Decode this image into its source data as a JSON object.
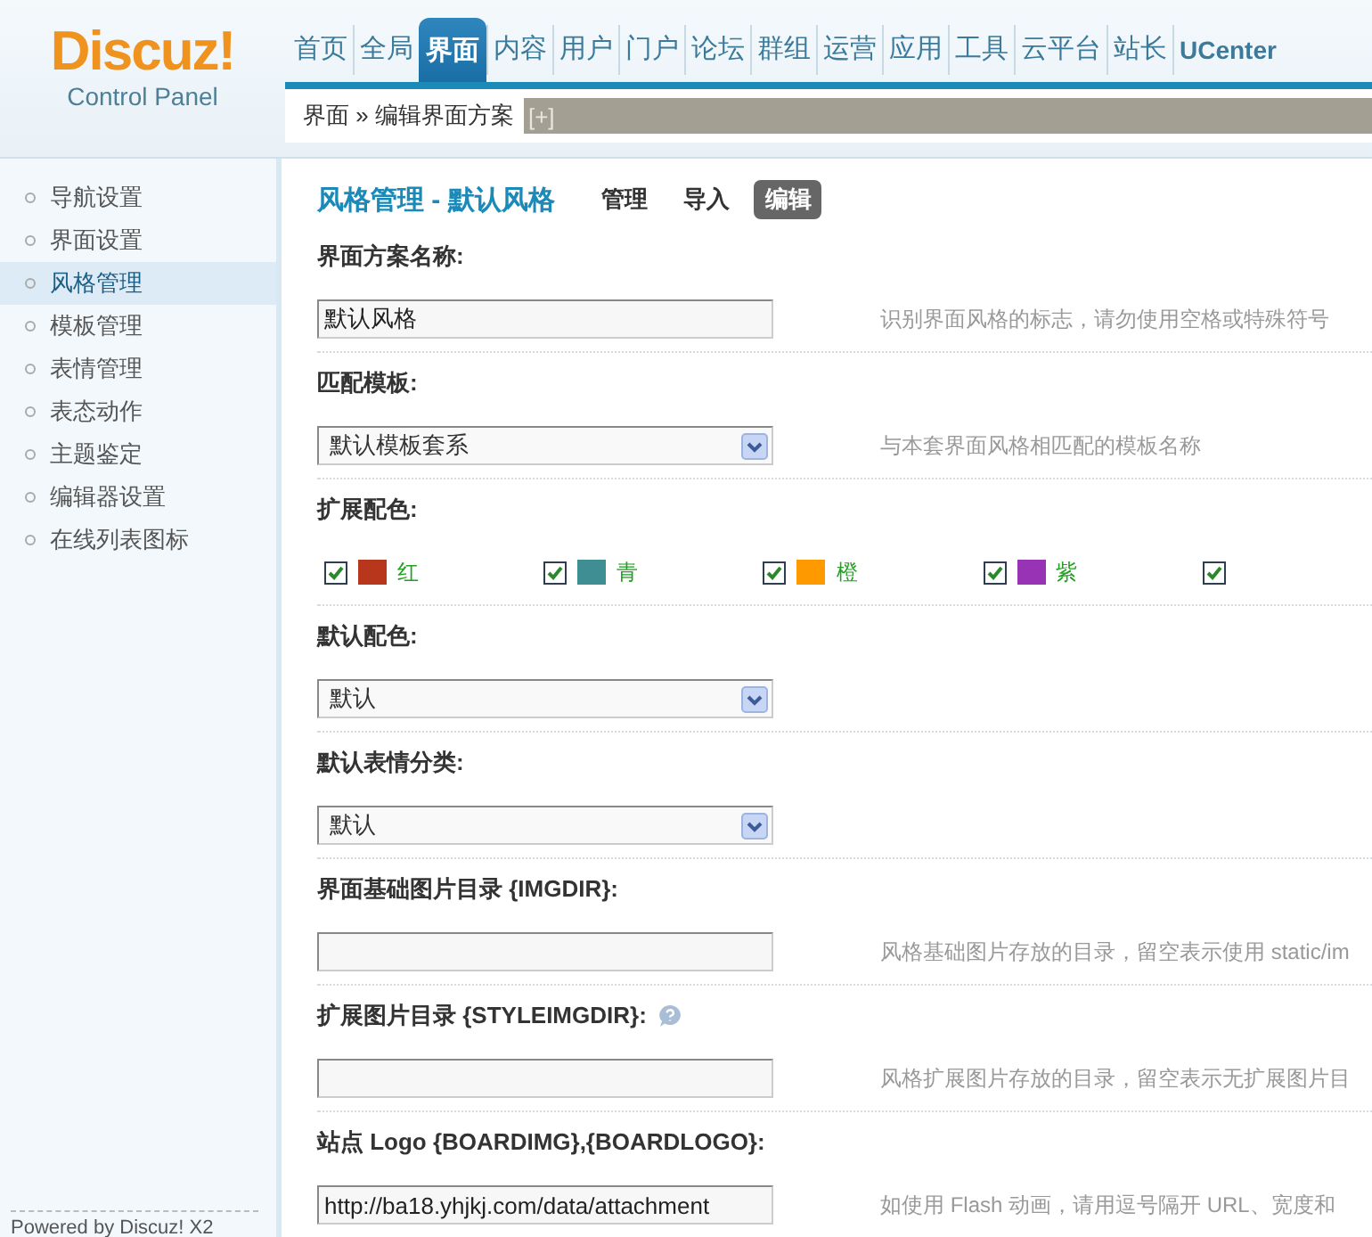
{
  "logo": {
    "title": "Discuz!",
    "subtitle": "Control Panel"
  },
  "nav": [
    {
      "label": "首页",
      "selected": false
    },
    {
      "label": "全局",
      "selected": false
    },
    {
      "label": "界面",
      "selected": true
    },
    {
      "label": "内容",
      "selected": false
    },
    {
      "label": "用户",
      "selected": false
    },
    {
      "label": "门户",
      "selected": false
    },
    {
      "label": "论坛",
      "selected": false
    },
    {
      "label": "群组",
      "selected": false
    },
    {
      "label": "运营",
      "selected": false
    },
    {
      "label": "应用",
      "selected": false
    },
    {
      "label": "工具",
      "selected": false
    },
    {
      "label": "云平台",
      "selected": false
    },
    {
      "label": "站长",
      "selected": false
    },
    {
      "label": "UCenter",
      "selected": false
    }
  ],
  "breadcrumb": {
    "text": "界面 » 编辑界面方案",
    "toggle": "[+]"
  },
  "sidebar": {
    "items": [
      {
        "label": "导航设置",
        "selected": false
      },
      {
        "label": "界面设置",
        "selected": false
      },
      {
        "label": "风格管理",
        "selected": true
      },
      {
        "label": "模板管理",
        "selected": false
      },
      {
        "label": "表情管理",
        "selected": false
      },
      {
        "label": "表态动作",
        "selected": false
      },
      {
        "label": "主题鉴定",
        "selected": false
      },
      {
        "label": "编辑器设置",
        "selected": false
      },
      {
        "label": "在线列表图标",
        "selected": false
      }
    ],
    "footer": "Powered by Discuz! X2"
  },
  "page": {
    "title": "风格管理 - 默认风格",
    "tabs": [
      {
        "label": "管理",
        "selected": false
      },
      {
        "label": "导入",
        "selected": false
      },
      {
        "label": "编辑",
        "selected": true
      }
    ],
    "rows": [
      {
        "kind": "text",
        "label": "界面方案名称:",
        "value": "默认风格",
        "hint": "识别界面风格的标志，请勿使用空格或特殊符号"
      },
      {
        "kind": "select",
        "label": "匹配模板:",
        "value": "默认模板套系",
        "hint": "与本套界面风格相匹配的模板名称"
      },
      {
        "kind": "colors",
        "label": "扩展配色:",
        "options": [
          {
            "label": "红",
            "color": "#b8361c",
            "checked": true
          },
          {
            "label": "青",
            "color": "#3f8e94",
            "checked": true
          },
          {
            "label": "橙",
            "color": "#ff9900",
            "checked": true
          },
          {
            "label": "紫",
            "color": "#9933b5",
            "checked": true
          },
          {
            "checked": true
          }
        ]
      },
      {
        "kind": "select",
        "label": "默认配色:",
        "value": "默认"
      },
      {
        "kind": "select",
        "label": "默认表情分类:",
        "value": "默认"
      },
      {
        "kind": "text",
        "label": "界面基础图片目录 {IMGDIR}:",
        "hint": "风格基础图片存放的目录，留空表示使用 static/im"
      },
      {
        "kind": "text",
        "label": "扩展图片目录 {STYLEIMGDIR}:",
        "help": true,
        "hint": "风格扩展图片存放的目录，留空表示无扩展图片目"
      },
      {
        "kind": "text",
        "label": "站点 Logo {BOARDIMG},{BOARDLOGO}:",
        "value": "http://ba18.yhjkj.com/data/attachment",
        "hint": "如使用 Flash 动画，请用逗号隔开 URL、宽度和"
      }
    ]
  }
}
